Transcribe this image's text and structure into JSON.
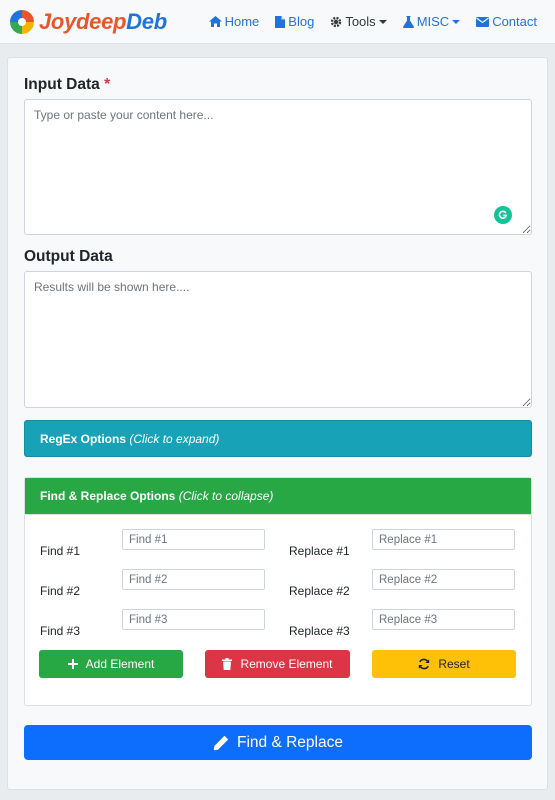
{
  "brand": {
    "part1": "Joydeep",
    "part2": "Deb"
  },
  "nav": {
    "home": "Home",
    "blog": "Blog",
    "tools": "Tools",
    "misc": "MISC",
    "contact": "Contact"
  },
  "input": {
    "label": "Input Data",
    "required_mark": "*",
    "placeholder": "Type or paste your content here..."
  },
  "output": {
    "label": "Output Data",
    "placeholder": "Results will be shown here...."
  },
  "regex_panel": {
    "title": "RegEx Options",
    "hint": "(Click to expand)"
  },
  "fr_panel": {
    "title": "Find & Replace Options",
    "hint": "(Click to collapse)"
  },
  "rows": [
    {
      "find_label": "Find #1",
      "find_placeholder": "Find #1",
      "replace_label": "Replace #1",
      "replace_placeholder": "Replace #1"
    },
    {
      "find_label": "Find #2",
      "find_placeholder": "Find #2",
      "replace_label": "Replace #2",
      "replace_placeholder": "Replace #2"
    },
    {
      "find_label": "Find #3",
      "find_placeholder": "Find #3",
      "replace_label": "Replace #3",
      "replace_placeholder": "Replace #3"
    }
  ],
  "buttons": {
    "add": "Add Element",
    "remove": "Remove Element",
    "reset": "Reset",
    "find_replace": "Find & Replace"
  },
  "colors": {
    "primary": "#0d6efd",
    "success": "#28a745",
    "danger": "#dc3545",
    "warning": "#ffc107",
    "info": "#17a2b8"
  }
}
